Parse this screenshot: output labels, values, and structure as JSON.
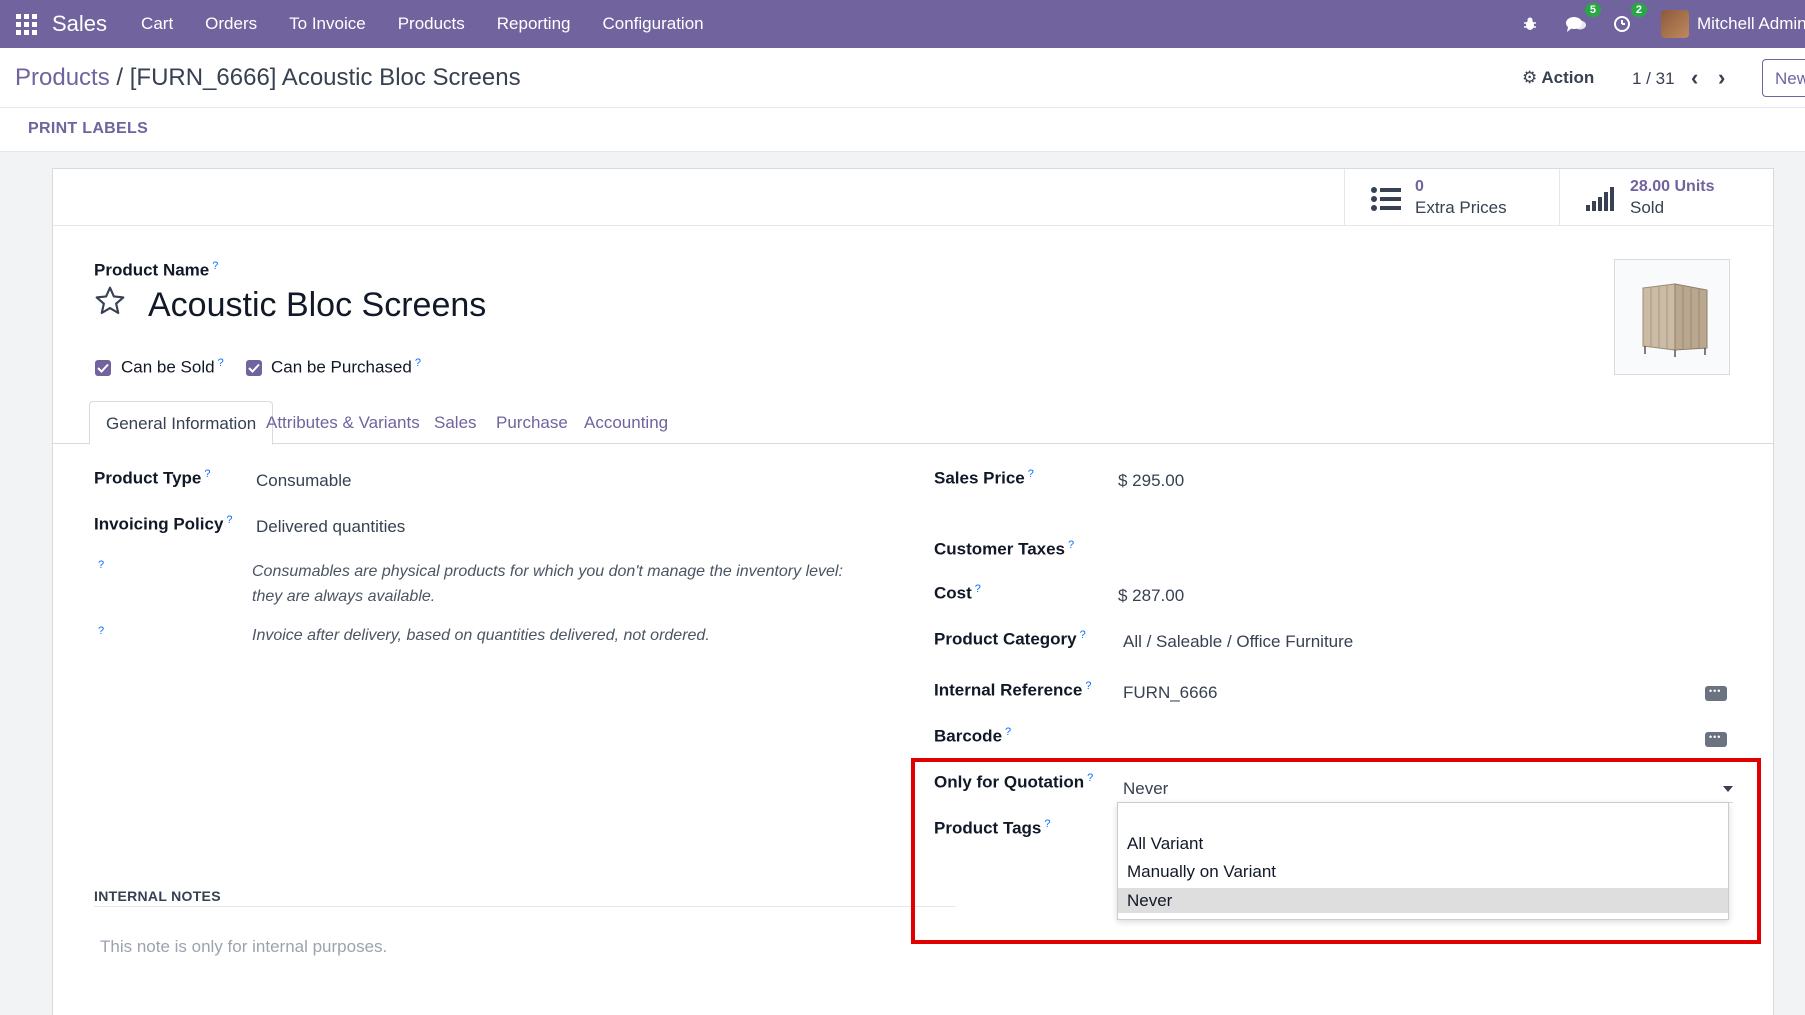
{
  "navbar": {
    "brand": "Sales",
    "menu": [
      "Cart",
      "Orders",
      "To Invoice",
      "Products",
      "Reporting",
      "Configuration"
    ],
    "messages_count": "5",
    "activities_count": "2",
    "user_name": "Mitchell Admin ("
  },
  "control": {
    "breadcrumb_parent": "Products",
    "breadcrumb_separator": "/",
    "breadcrumb_current": "[FURN_6666] Acoustic Bloc Screens",
    "action_label": "Action",
    "pager": "1 / 31",
    "new_label": "New"
  },
  "status_bar": {
    "print_labels": "PRINT LABELS"
  },
  "stat_buttons": {
    "extra_prices": {
      "value": "0",
      "label": "Extra Prices"
    },
    "units_sold": {
      "value": "28.00 Units",
      "label": "Sold"
    }
  },
  "product": {
    "name_label": "Product Name",
    "name": "Acoustic Bloc Screens",
    "can_be_sold": "Can be Sold",
    "can_be_purchased": "Can be Purchased"
  },
  "tabs": [
    "General Information",
    "Attributes & Variants",
    "Sales",
    "Purchase",
    "Accounting"
  ],
  "general": {
    "product_type_label": "Product Type",
    "product_type": "Consumable",
    "invoicing_policy_label": "Invoicing Policy",
    "invoicing_policy": "Delivered quantities",
    "help_type_line1": "Consumables are physical products for which you don't manage the inventory level:",
    "help_type_line2": "they are always available.",
    "help_invoice": "Invoice after delivery, based on quantities delivered, not ordered.",
    "sales_price_label": "Sales Price",
    "sales_price": "$ 295.00",
    "customer_taxes_label": "Customer Taxes",
    "cost_label": "Cost",
    "cost": "$ 287.00",
    "product_category_label": "Product Category",
    "product_category": "All / Saleable / Office Furniture",
    "internal_reference_label": "Internal Reference",
    "internal_reference": "FURN_6666",
    "barcode_label": "Barcode",
    "only_for_quotation_label": "Only for Quotation",
    "only_for_quotation": "Never",
    "product_tags_label": "Product Tags"
  },
  "dropdown_options": [
    "All Variant",
    "Manually on Variant",
    "Never"
  ],
  "notes": {
    "heading": "INTERNAL NOTES",
    "placeholder": "This note is only for internal purposes."
  },
  "help_marker": "?",
  "colors": {
    "brand": "#71639e",
    "highlight": "#e00000",
    "badge": "#28a745"
  }
}
